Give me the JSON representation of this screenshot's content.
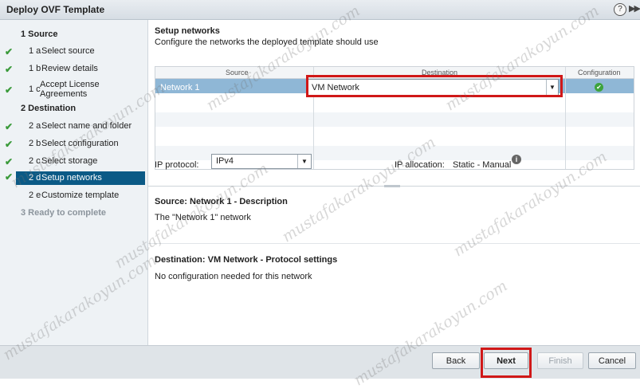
{
  "window": {
    "title": "Deploy OVF Template",
    "help_glyph": "?",
    "collapse_glyph": "▶▶"
  },
  "steps": [
    {
      "label": "1 Source",
      "type": "section",
      "state": "done"
    },
    {
      "num": "1 a",
      "label": "Select source",
      "state": "done"
    },
    {
      "num": "1 b",
      "label": "Review details",
      "state": "done"
    },
    {
      "num": "1 c",
      "label": "Accept License",
      "label2": "Agreements",
      "state": "done"
    },
    {
      "label": "2 Destination",
      "type": "section",
      "state": "done"
    },
    {
      "num": "2 a",
      "label": "Select name and folder",
      "state": "done"
    },
    {
      "num": "2 b",
      "label": "Select configuration",
      "state": "done"
    },
    {
      "num": "2 c",
      "label": "Select storage",
      "state": "done"
    },
    {
      "num": "2 d",
      "label": "Setup networks",
      "state": "active"
    },
    {
      "num": "2 e",
      "label": "Customize template",
      "state": "pending"
    },
    {
      "label": "3 Ready to complete",
      "type": "section",
      "state": "disabled"
    }
  ],
  "main": {
    "title": "Setup networks",
    "subtitle": "Configure the networks the deployed template should use",
    "table": {
      "columns": [
        "Source",
        "Destination",
        "Configuration"
      ],
      "rows": [
        {
          "source": "Network 1",
          "destination": "VM Network",
          "configuration": "ok"
        }
      ]
    },
    "ip_protocol": {
      "label": "IP protocol:",
      "value": "IPv4"
    },
    "ip_allocation": {
      "label": "IP allocation:",
      "value": "Static - Manual"
    },
    "source_desc": {
      "title": "Source: Network 1 - Description",
      "text": "The \"Network 1\" network"
    },
    "dest_desc": {
      "title": "Destination: VM Network - Protocol settings",
      "text": "No configuration needed for this network"
    }
  },
  "buttons": {
    "back": "Back",
    "next": "Next",
    "finish": "Finish",
    "cancel": "Cancel"
  },
  "watermark": "mustafakarakoyun.com",
  "colors": {
    "active_step": "#0b5a86",
    "selected_row": "#8fb7d6",
    "highlight": "#d01818",
    "check": "#3a9a3a"
  }
}
